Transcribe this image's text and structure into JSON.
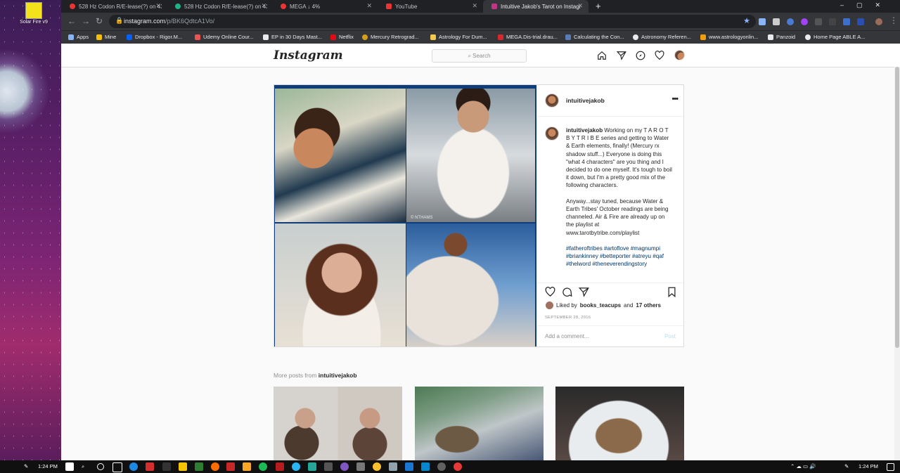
{
  "desktop": {
    "icon_label": "Solar Fire v9"
  },
  "browser": {
    "tabs": [
      {
        "title": "528 Hz Codon R/E-lease(?) on 43",
        "active": false
      },
      {
        "title": "528 Hz Codon R/E-lease(?) on 43",
        "active": false
      },
      {
        "title": "MEGA ↓ 4%",
        "active": false
      },
      {
        "title": "YouTube",
        "active": false
      },
      {
        "title": "Intuitive Jakob's Tarot on Instagr",
        "active": true
      }
    ],
    "url_host": "instagram.com",
    "url_path": "/p/BK6QdtcA1Vo/",
    "bookmarks": [
      "Apps",
      "Mine",
      "Dropbox - Rigor.M...",
      "Udemy Online Cour...",
      "EP in 30 Days Mast...",
      "Netflix",
      "Mercury Retrograd...",
      "Astrology For Dum...",
      "MEGA.Dis-trial.drau...",
      "Calculating the Con...",
      "Astronomy Referen...",
      "www.astrologyonlin...",
      "Panzoid",
      "Home Page ABLE A..."
    ]
  },
  "instagram": {
    "logo": "Instagram",
    "search_placeholder": "Search",
    "post": {
      "username": "intuitivejakob",
      "caption_user": "intuitivejakob",
      "caption_p1": "Working on my T A R O T B Y T R I B E series and getting to Water & Earth elements, finally! (Mercury rx shadow stuff...) Everyone is doing this \"what 4 characters\" are you thing and I decided to do one myself. It's tough to boil it down, but I'm a pretty good mix of the following characters.",
      "caption_p2": "Anyway...stay tuned, because Water & Earth Tribes' October readings are being channeled. Air & Fire are already up on the playlist at www.tarotbytribe.com/playlist",
      "hashtags": "#fatheroftribes #artoflove #magnumpi #briankinney #betteporter #atreyu #qaf #thelword #theneverendingstory",
      "liked_by_prefix": "Liked by",
      "liked_by_user": "books_teacups",
      "liked_by_and": "and",
      "liked_by_others": "17 others",
      "date": "SEPTEMBER 28, 2016",
      "comment_placeholder": "Add a comment...",
      "post_button": "Post",
      "photo_watermark": "© NTHAMS"
    },
    "more_posts_prefix": "More posts from",
    "more_posts_user": "intuitivejakob"
  },
  "taskbar": {
    "time_left": "1:24 PM",
    "time_right": "1:24 PM"
  },
  "colors": {
    "ig_link": "#003569",
    "chrome_dark": "#202124",
    "accent_blue": "#8ab4f8"
  }
}
